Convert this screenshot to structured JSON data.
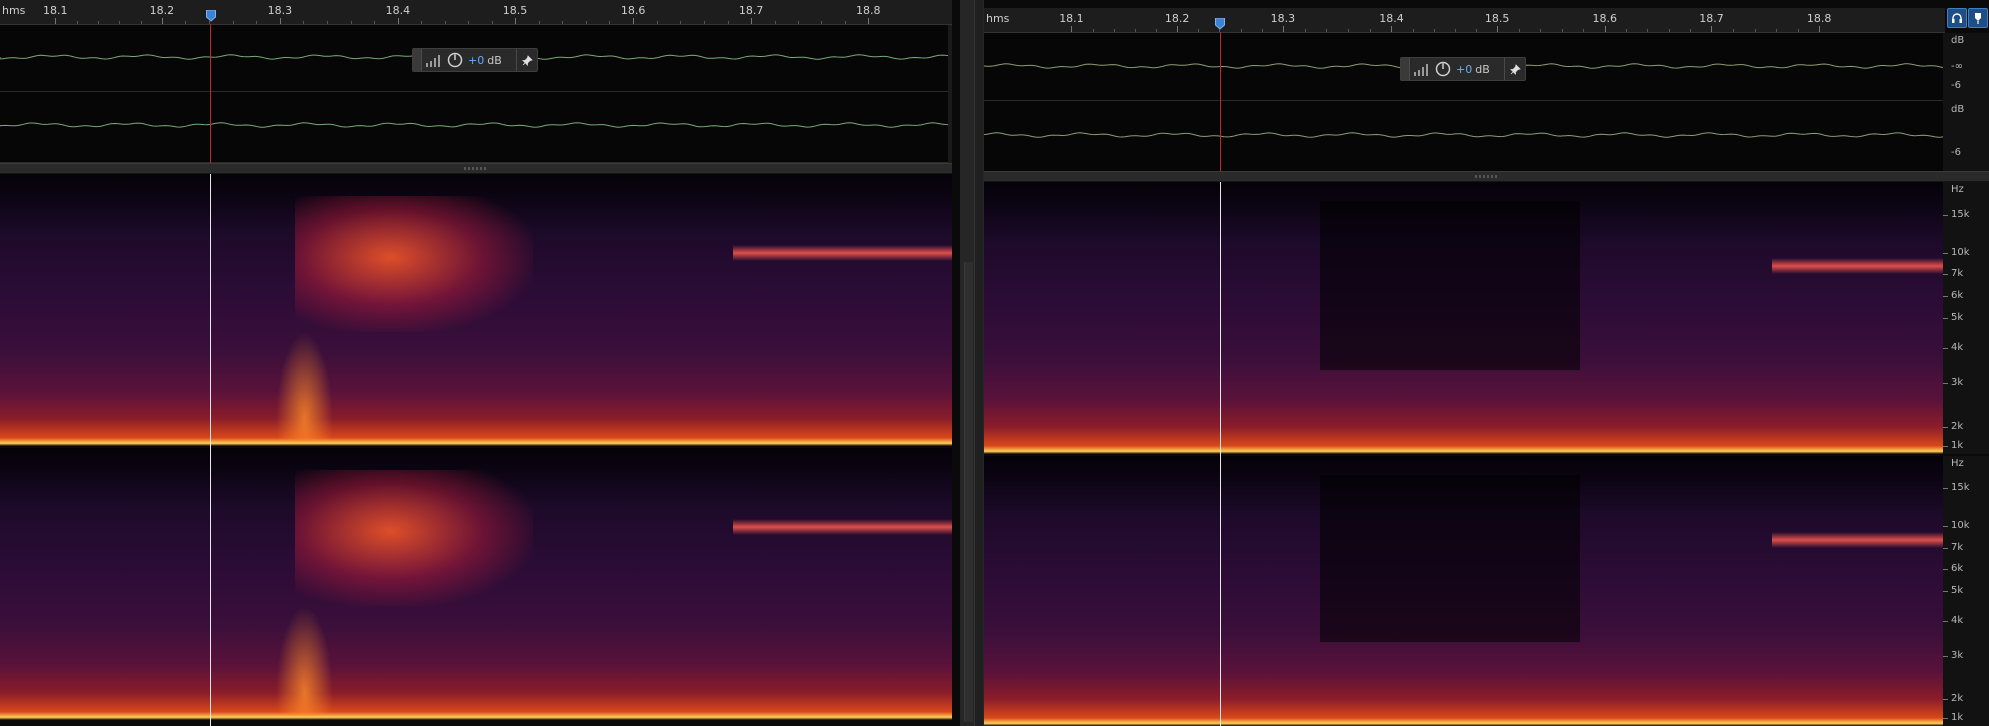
{
  "left_pane": {
    "ruler_unit": "hms",
    "ticks": [
      {
        "label": "18.1",
        "pos": 0.058
      },
      {
        "label": "18.2",
        "pos": 0.17
      },
      {
        "label": "18.3",
        "pos": 0.294
      },
      {
        "label": "18.4",
        "pos": 0.418
      },
      {
        "label": "18.5",
        "pos": 0.541
      },
      {
        "label": "18.6",
        "pos": 0.665
      },
      {
        "label": "18.7",
        "pos": 0.789
      },
      {
        "label": "18.8",
        "pos": 0.912
      }
    ],
    "gain_hud": {
      "value": "+0",
      "unit": "dB"
    }
  },
  "right_pane": {
    "ruler_unit": "hms",
    "ticks": [
      {
        "label": "18.1",
        "pos": 0.091
      },
      {
        "label": "18.2",
        "pos": 0.201
      },
      {
        "label": "18.3",
        "pos": 0.311
      },
      {
        "label": "18.4",
        "pos": 0.424
      },
      {
        "label": "18.5",
        "pos": 0.534
      },
      {
        "label": "18.6",
        "pos": 0.646
      },
      {
        "label": "18.7",
        "pos": 0.757
      },
      {
        "label": "18.8",
        "pos": 0.869
      }
    ],
    "gain_hud": {
      "value": "+0",
      "unit": "dB"
    },
    "amp_scale": {
      "unit": "dB",
      "labels": [
        "-∞",
        "-6"
      ]
    },
    "freq_scale": {
      "unit": "Hz",
      "labels": [
        "15k",
        "10k",
        "7k",
        "6k",
        "5k",
        "4k",
        "3k",
        "2k",
        "1k"
      ]
    }
  },
  "icons": {
    "headphones": "headphones-icon",
    "marker": "marker-flag-icon",
    "pin": "pin-icon",
    "gain_knob": "gain-knob-icon",
    "level_meter": "level-meter-icon"
  },
  "colors": {
    "playhead": "#3b82d6",
    "cursor_line": "#e8e8e8",
    "playhead_line": "#c0262d",
    "waveform": "#7aa878",
    "accent_value": "#6fa8ff"
  }
}
